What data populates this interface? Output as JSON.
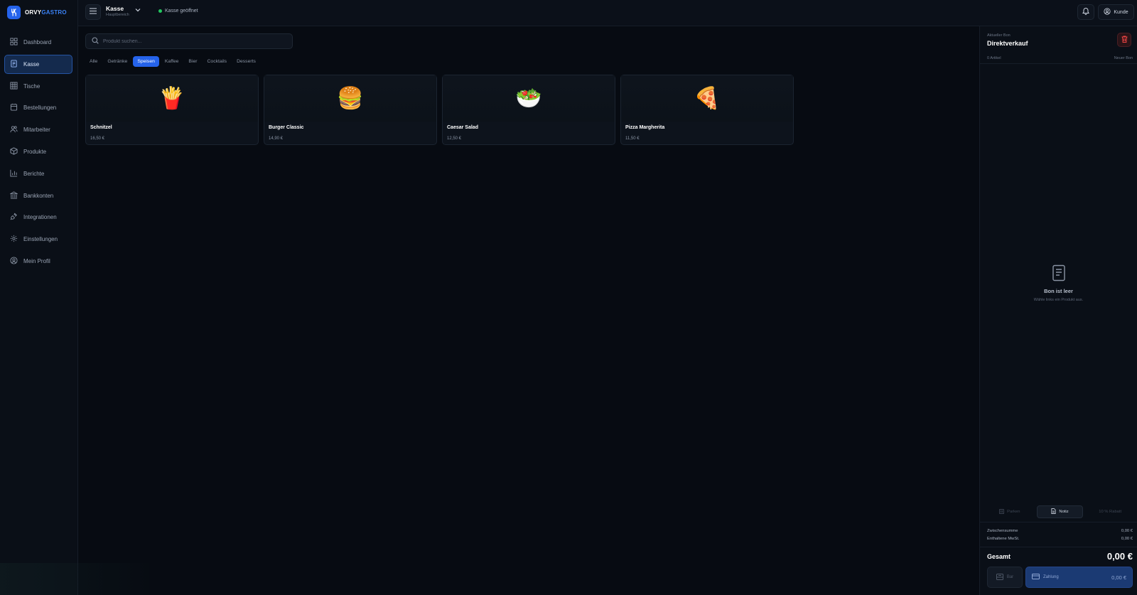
{
  "brand": {
    "name_a": "ORVY",
    "name_b": "GASTRO",
    "accent": "#2563eb"
  },
  "nav": [
    {
      "label": "Dashboard",
      "icon": "dashboard-icon",
      "active": false
    },
    {
      "label": "Kasse",
      "icon": "receipt-icon",
      "active": true
    },
    {
      "label": "Tische",
      "icon": "table-grid-icon",
      "active": false
    },
    {
      "label": "Bestellungen",
      "icon": "orders-icon",
      "active": false
    },
    {
      "label": "Mitarbeiter",
      "icon": "users-icon",
      "active": false
    },
    {
      "label": "Produkte",
      "icon": "box-icon",
      "active": false
    },
    {
      "label": "Berichte",
      "icon": "chart-icon",
      "active": false
    },
    {
      "label": "Bankkonten",
      "icon": "bank-icon",
      "active": false
    },
    {
      "label": "Integrationen",
      "icon": "plug-icon",
      "active": false
    },
    {
      "label": "Einstellungen",
      "icon": "gear-icon",
      "active": false
    },
    {
      "label": "Mein Profil",
      "icon": "profile-icon",
      "active": false
    }
  ],
  "header": {
    "title": "Kasse",
    "subtitle": "Hauptbereich",
    "status": "Kasse geöffnet",
    "status_color": "#22c55e",
    "customer_label": "Kunde"
  },
  "search": {
    "placeholder": "Produkt suchen..."
  },
  "tabs": [
    {
      "label": "Alle",
      "active": false
    },
    {
      "label": "Getränke",
      "active": false
    },
    {
      "label": "Speisen",
      "active": true
    },
    {
      "label": "Kaffee",
      "active": false
    },
    {
      "label": "Bier",
      "active": false
    },
    {
      "label": "Cocktails",
      "active": false
    },
    {
      "label": "Desserts",
      "active": false
    }
  ],
  "products": [
    {
      "name": "Schnitzel",
      "price": "16,50 €",
      "emoji": "🍟"
    },
    {
      "name": "Burger Classic",
      "price": "14,90 €",
      "emoji": "🍔"
    },
    {
      "name": "Caesar Salad",
      "price": "12,50 €",
      "emoji": "🥗"
    },
    {
      "name": "Pizza Margherita",
      "price": "11,50 €",
      "emoji": "🍕"
    }
  ],
  "panel": {
    "kicker": "Aktueller Bon",
    "title": "Direktverkauf",
    "items_count": "0 Artikel",
    "new_bon": "Neuer Bon",
    "empty_title": "Bon ist leer",
    "empty_sub": "Wähle links ein Produkt aus.",
    "actions": [
      {
        "label": "Parken",
        "active": false
      },
      {
        "label": "Notiz",
        "active": true
      },
      {
        "label": "10 % Rabatt",
        "active": false
      }
    ],
    "subtotal_label": "Zwischensumme",
    "subtotal_value": "0,00 €",
    "vat_label": "Enthaltene MwSt.",
    "vat_value": "0,00 €",
    "total_label": "Gesamt",
    "total_value": "0,00 €",
    "cash_label": "Bar",
    "pay_label": "Zahlung",
    "pay_value": "0,00 €"
  }
}
